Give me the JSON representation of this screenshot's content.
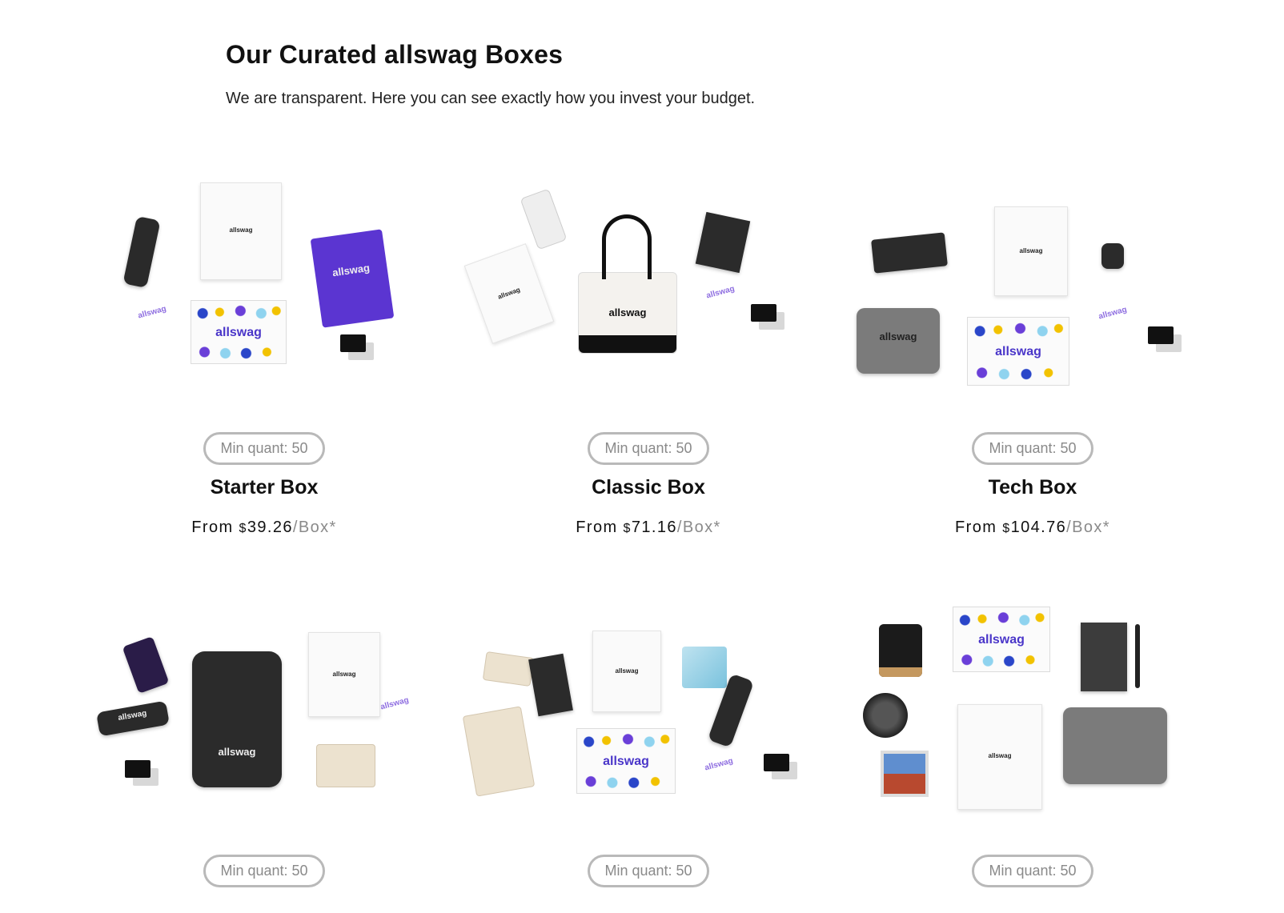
{
  "header": {
    "title": "Our Curated allswag Boxes",
    "subtitle": "We are transparent. Here you can see exactly how you invest your budget."
  },
  "brand": {
    "logo_text": "allswag",
    "accent": "#5b35d1"
  },
  "boxes": [
    {
      "badge": "Min quant: 50",
      "name": "Starter Box",
      "from": "From",
      "currency": "$",
      "price": "39.26",
      "unit": "/Box*"
    },
    {
      "badge": "Min quant: 50",
      "name": "Classic Box",
      "from": "From",
      "currency": "$",
      "price": "71.16",
      "unit": "/Box*"
    },
    {
      "badge": "Min quant: 50",
      "name": "Tech Box",
      "from": "From",
      "currency": "$",
      "price": "104.76",
      "unit": "/Box*"
    },
    {
      "badge": "Min quant: 50"
    },
    {
      "badge": "Min quant: 50"
    },
    {
      "badge": "Min quant: 50"
    }
  ]
}
